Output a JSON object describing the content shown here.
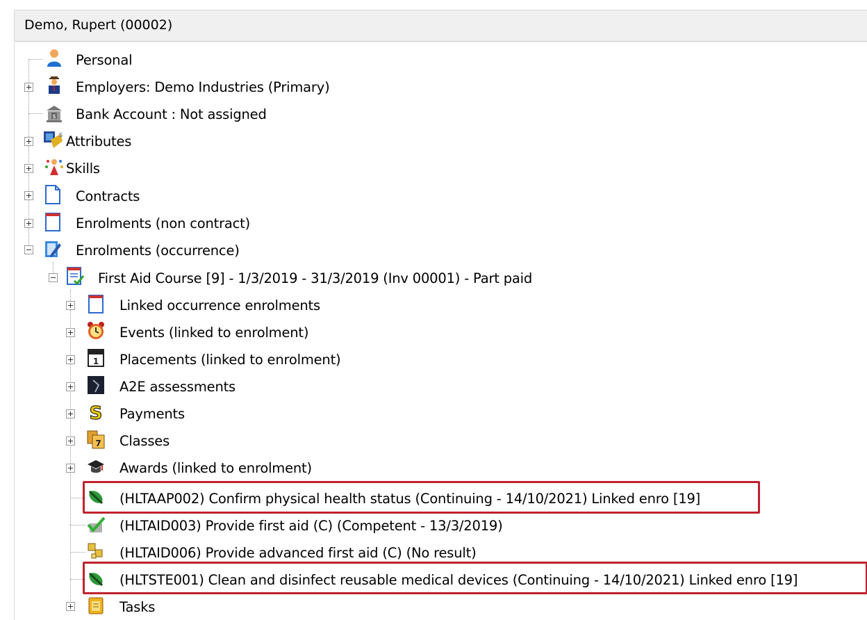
{
  "window": {
    "title": "Demo, Rupert (00002)"
  },
  "tree": {
    "root_items": [
      {
        "label": "Personal",
        "icon": "person-icon"
      },
      {
        "label": "Employers: Demo Industries (Primary)",
        "icon": "employer-icon"
      },
      {
        "label": "Bank Account : Not assigned",
        "icon": "bank-icon"
      },
      {
        "label": "Attributes",
        "icon": "attributes-icon"
      },
      {
        "label": "Skills",
        "icon": "skills-icon"
      },
      {
        "label": "Contracts",
        "icon": "document-icon"
      },
      {
        "label": "Enrolments (non contract)",
        "icon": "enrolment-icon"
      },
      {
        "label": "Enrolments (occurrence)",
        "icon": "edit-document-icon"
      }
    ],
    "enrolment": {
      "label": "First Aid Course [9] - 1/3/2019 - 31/3/2019 (Inv 00001) - Part paid",
      "icon": "enrolment-check-icon",
      "children": [
        {
          "label": "Linked occurrence enrolments",
          "icon": "enrolment-icon"
        },
        {
          "label": "Events (linked to enrolment)",
          "icon": "alarm-clock-icon"
        },
        {
          "label": "Placements (linked to enrolment)",
          "icon": "calendar-icon"
        },
        {
          "label": "A2E assessments",
          "icon": "assessment-icon"
        },
        {
          "label": "Payments",
          "icon": "dollar-icon"
        },
        {
          "label": "Classes",
          "icon": "classes-calendar-icon"
        },
        {
          "label": "Awards (linked to enrolment)",
          "icon": "graduation-cap-icon"
        },
        {
          "label": "(HLTAAP002) Confirm physical health status (Continuing - 14/10/2021) Linked enro [19]",
          "icon": "continuing-icon"
        },
        {
          "label": "(HLTAID003) Provide first aid (C) (Competent - 13/3/2019)",
          "icon": "competent-check-icon"
        },
        {
          "label": "(HLTAID006) Provide advanced first aid (C) (No result)",
          "icon": "boxes-icon"
        },
        {
          "label": "(HLTSTE001) Clean and disinfect reusable medical devices (Continuing - 14/10/2021) Linked enro [19]",
          "icon": "continuing-icon"
        },
        {
          "label": "Tasks",
          "icon": "tasks-icon"
        }
      ]
    }
  },
  "colors": {
    "highlight": "#c0212e",
    "icon_blue": "#1e6fd0",
    "icon_green": "#1e8a2e"
  }
}
